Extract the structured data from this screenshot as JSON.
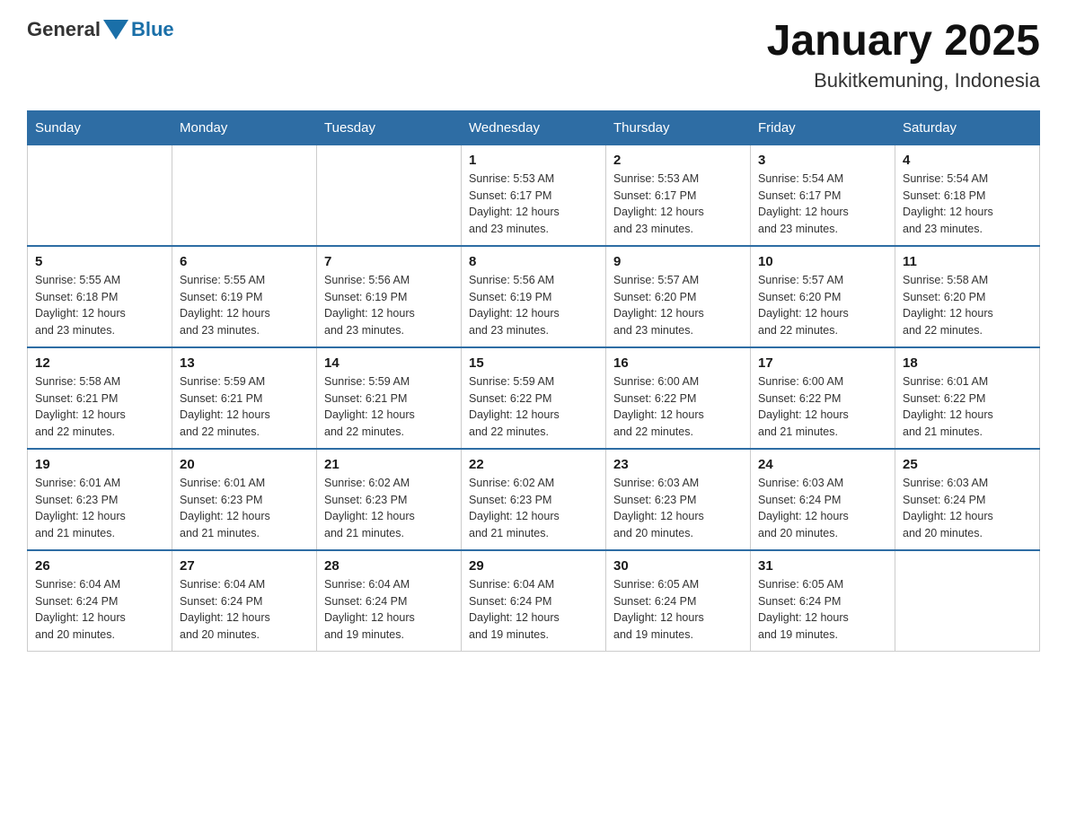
{
  "header": {
    "logo_general": "General",
    "logo_blue": "Blue",
    "title": "January 2025",
    "subtitle": "Bukitkemuning, Indonesia"
  },
  "days_of_week": [
    "Sunday",
    "Monday",
    "Tuesday",
    "Wednesday",
    "Thursday",
    "Friday",
    "Saturday"
  ],
  "weeks": [
    [
      {
        "num": "",
        "info": ""
      },
      {
        "num": "",
        "info": ""
      },
      {
        "num": "",
        "info": ""
      },
      {
        "num": "1",
        "info": "Sunrise: 5:53 AM\nSunset: 6:17 PM\nDaylight: 12 hours\nand 23 minutes."
      },
      {
        "num": "2",
        "info": "Sunrise: 5:53 AM\nSunset: 6:17 PM\nDaylight: 12 hours\nand 23 minutes."
      },
      {
        "num": "3",
        "info": "Sunrise: 5:54 AM\nSunset: 6:17 PM\nDaylight: 12 hours\nand 23 minutes."
      },
      {
        "num": "4",
        "info": "Sunrise: 5:54 AM\nSunset: 6:18 PM\nDaylight: 12 hours\nand 23 minutes."
      }
    ],
    [
      {
        "num": "5",
        "info": "Sunrise: 5:55 AM\nSunset: 6:18 PM\nDaylight: 12 hours\nand 23 minutes."
      },
      {
        "num": "6",
        "info": "Sunrise: 5:55 AM\nSunset: 6:19 PM\nDaylight: 12 hours\nand 23 minutes."
      },
      {
        "num": "7",
        "info": "Sunrise: 5:56 AM\nSunset: 6:19 PM\nDaylight: 12 hours\nand 23 minutes."
      },
      {
        "num": "8",
        "info": "Sunrise: 5:56 AM\nSunset: 6:19 PM\nDaylight: 12 hours\nand 23 minutes."
      },
      {
        "num": "9",
        "info": "Sunrise: 5:57 AM\nSunset: 6:20 PM\nDaylight: 12 hours\nand 23 minutes."
      },
      {
        "num": "10",
        "info": "Sunrise: 5:57 AM\nSunset: 6:20 PM\nDaylight: 12 hours\nand 22 minutes."
      },
      {
        "num": "11",
        "info": "Sunrise: 5:58 AM\nSunset: 6:20 PM\nDaylight: 12 hours\nand 22 minutes."
      }
    ],
    [
      {
        "num": "12",
        "info": "Sunrise: 5:58 AM\nSunset: 6:21 PM\nDaylight: 12 hours\nand 22 minutes."
      },
      {
        "num": "13",
        "info": "Sunrise: 5:59 AM\nSunset: 6:21 PM\nDaylight: 12 hours\nand 22 minutes."
      },
      {
        "num": "14",
        "info": "Sunrise: 5:59 AM\nSunset: 6:21 PM\nDaylight: 12 hours\nand 22 minutes."
      },
      {
        "num": "15",
        "info": "Sunrise: 5:59 AM\nSunset: 6:22 PM\nDaylight: 12 hours\nand 22 minutes."
      },
      {
        "num": "16",
        "info": "Sunrise: 6:00 AM\nSunset: 6:22 PM\nDaylight: 12 hours\nand 22 minutes."
      },
      {
        "num": "17",
        "info": "Sunrise: 6:00 AM\nSunset: 6:22 PM\nDaylight: 12 hours\nand 21 minutes."
      },
      {
        "num": "18",
        "info": "Sunrise: 6:01 AM\nSunset: 6:22 PM\nDaylight: 12 hours\nand 21 minutes."
      }
    ],
    [
      {
        "num": "19",
        "info": "Sunrise: 6:01 AM\nSunset: 6:23 PM\nDaylight: 12 hours\nand 21 minutes."
      },
      {
        "num": "20",
        "info": "Sunrise: 6:01 AM\nSunset: 6:23 PM\nDaylight: 12 hours\nand 21 minutes."
      },
      {
        "num": "21",
        "info": "Sunrise: 6:02 AM\nSunset: 6:23 PM\nDaylight: 12 hours\nand 21 minutes."
      },
      {
        "num": "22",
        "info": "Sunrise: 6:02 AM\nSunset: 6:23 PM\nDaylight: 12 hours\nand 21 minutes."
      },
      {
        "num": "23",
        "info": "Sunrise: 6:03 AM\nSunset: 6:23 PM\nDaylight: 12 hours\nand 20 minutes."
      },
      {
        "num": "24",
        "info": "Sunrise: 6:03 AM\nSunset: 6:24 PM\nDaylight: 12 hours\nand 20 minutes."
      },
      {
        "num": "25",
        "info": "Sunrise: 6:03 AM\nSunset: 6:24 PM\nDaylight: 12 hours\nand 20 minutes."
      }
    ],
    [
      {
        "num": "26",
        "info": "Sunrise: 6:04 AM\nSunset: 6:24 PM\nDaylight: 12 hours\nand 20 minutes."
      },
      {
        "num": "27",
        "info": "Sunrise: 6:04 AM\nSunset: 6:24 PM\nDaylight: 12 hours\nand 20 minutes."
      },
      {
        "num": "28",
        "info": "Sunrise: 6:04 AM\nSunset: 6:24 PM\nDaylight: 12 hours\nand 19 minutes."
      },
      {
        "num": "29",
        "info": "Sunrise: 6:04 AM\nSunset: 6:24 PM\nDaylight: 12 hours\nand 19 minutes."
      },
      {
        "num": "30",
        "info": "Sunrise: 6:05 AM\nSunset: 6:24 PM\nDaylight: 12 hours\nand 19 minutes."
      },
      {
        "num": "31",
        "info": "Sunrise: 6:05 AM\nSunset: 6:24 PM\nDaylight: 12 hours\nand 19 minutes."
      },
      {
        "num": "",
        "info": ""
      }
    ]
  ]
}
